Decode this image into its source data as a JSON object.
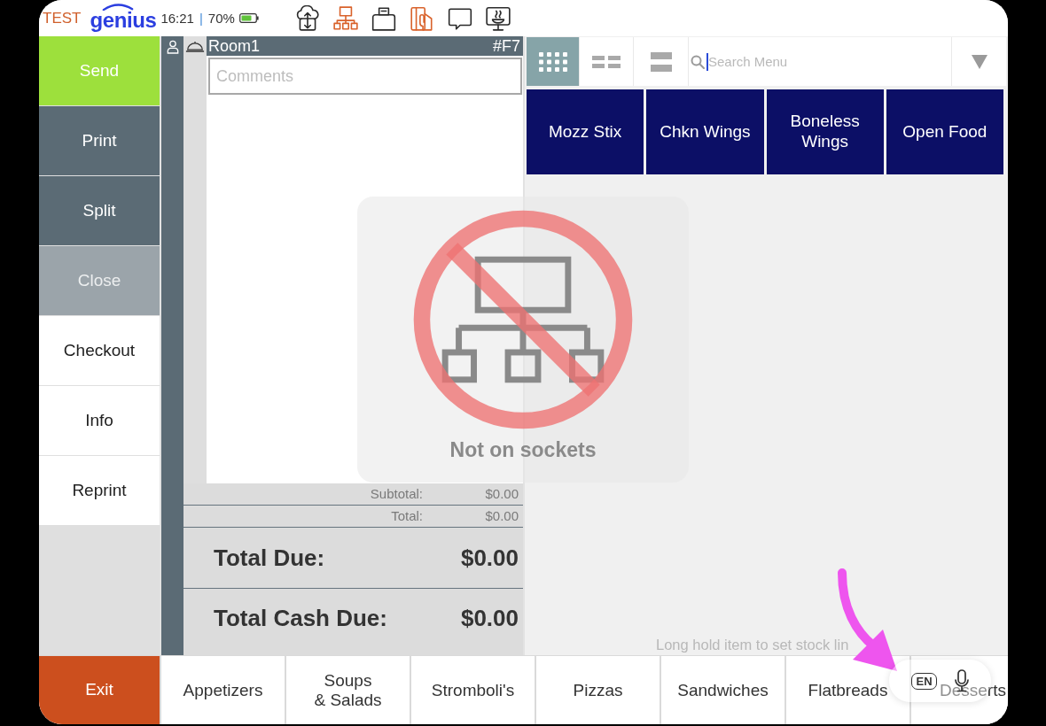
{
  "status_bar": {
    "environment": "TEST",
    "brand": "genius",
    "time": "16:21",
    "separator": "|",
    "battery": "70%",
    "icons": [
      {
        "kind": "cloud-sync",
        "alert": false
      },
      {
        "kind": "network",
        "alert": true
      },
      {
        "kind": "printer",
        "alert": false
      },
      {
        "kind": "card-reader",
        "alert": true
      },
      {
        "kind": "chat",
        "alert": false
      },
      {
        "kind": "kitchen-display",
        "alert": false
      }
    ]
  },
  "actions": [
    {
      "label": "Send",
      "kind": "send",
      "disabled": false
    },
    {
      "label": "Print",
      "kind": "dark",
      "disabled": false
    },
    {
      "label": "Split",
      "kind": "dark",
      "disabled": false
    },
    {
      "label": "Close",
      "kind": "dark",
      "disabled": true
    },
    {
      "label": "Checkout",
      "kind": "plain",
      "disabled": false
    },
    {
      "label": "Info",
      "kind": "plain",
      "disabled": false
    },
    {
      "label": "Reprint",
      "kind": "plain",
      "disabled": false
    }
  ],
  "order": {
    "room": "Room1",
    "check": "#F7",
    "comments": {
      "placeholder": "Comments"
    },
    "totals": [
      {
        "label": "Subtotal:",
        "value": "$0.00",
        "kind": "minor"
      },
      {
        "label": "Total:",
        "value": "$0.00",
        "kind": "minor"
      },
      {
        "label": "Total Due:",
        "value": "$0.00",
        "kind": "major"
      },
      {
        "label": "Total Cash Due:",
        "value": "$0.00",
        "kind": "major"
      }
    ]
  },
  "view_modes": [
    {
      "kind": "grid",
      "selected": true
    },
    {
      "kind": "columns",
      "selected": false
    },
    {
      "kind": "list",
      "selected": false
    }
  ],
  "search": {
    "placeholder": "Search Menu",
    "focused": true
  },
  "menu_items": [
    "Mozz Stix",
    "Chkn Wings",
    "Boneless Wings",
    "Open Food"
  ],
  "hint": "Long hold item to set stock lin",
  "connection_overlay": {
    "message": "Not on sockets"
  },
  "exit_button": "Exit",
  "categories": [
    "Appetizers",
    "Soups\n& Salads",
    "Stromboli's",
    "Pizzas",
    "Sandwiches",
    "Flatbreads",
    "Desserts"
  ],
  "dictation_popup": {
    "language": "EN"
  }
}
